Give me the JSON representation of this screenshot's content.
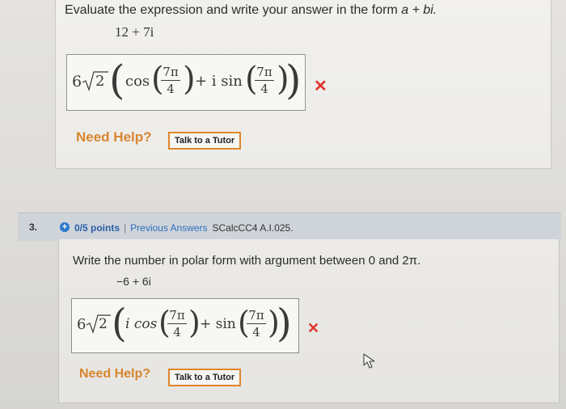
{
  "q2": {
    "prompt_before": "Evaluate the expression and write your answer in the form ",
    "prompt_form": "a + bi.",
    "expression": "12 + 7i",
    "answer": {
      "coef": "6",
      "sqrt_arg": "2",
      "cos": "cos",
      "plus_i_sin": "+ i sin",
      "num": "7π",
      "den": "4"
    },
    "status": "incorrect",
    "need_help": "Need Help?",
    "tutor_button": "Talk to a Tutor"
  },
  "q3": {
    "number": "3.",
    "points": "0/5 points",
    "separator": "|",
    "previous_answers": "Previous Answers",
    "problem_code": "SCalcCC4 A.I.025.",
    "prompt": "Write the number in polar form with argument between 0 and 2π.",
    "expression": "−6 + 6i",
    "answer": {
      "coef": "6",
      "sqrt_arg": "2",
      "i_cos": "i cos",
      "plus_sin": "+ sin",
      "num": "7π",
      "den": "4"
    },
    "status": "incorrect",
    "need_help": "Need Help?",
    "tutor_button": "Talk to a Tutor"
  },
  "colors": {
    "error": "#e0332c",
    "help": "#d9852f",
    "link": "#2a6fbf",
    "points": "#2a5fa8"
  }
}
